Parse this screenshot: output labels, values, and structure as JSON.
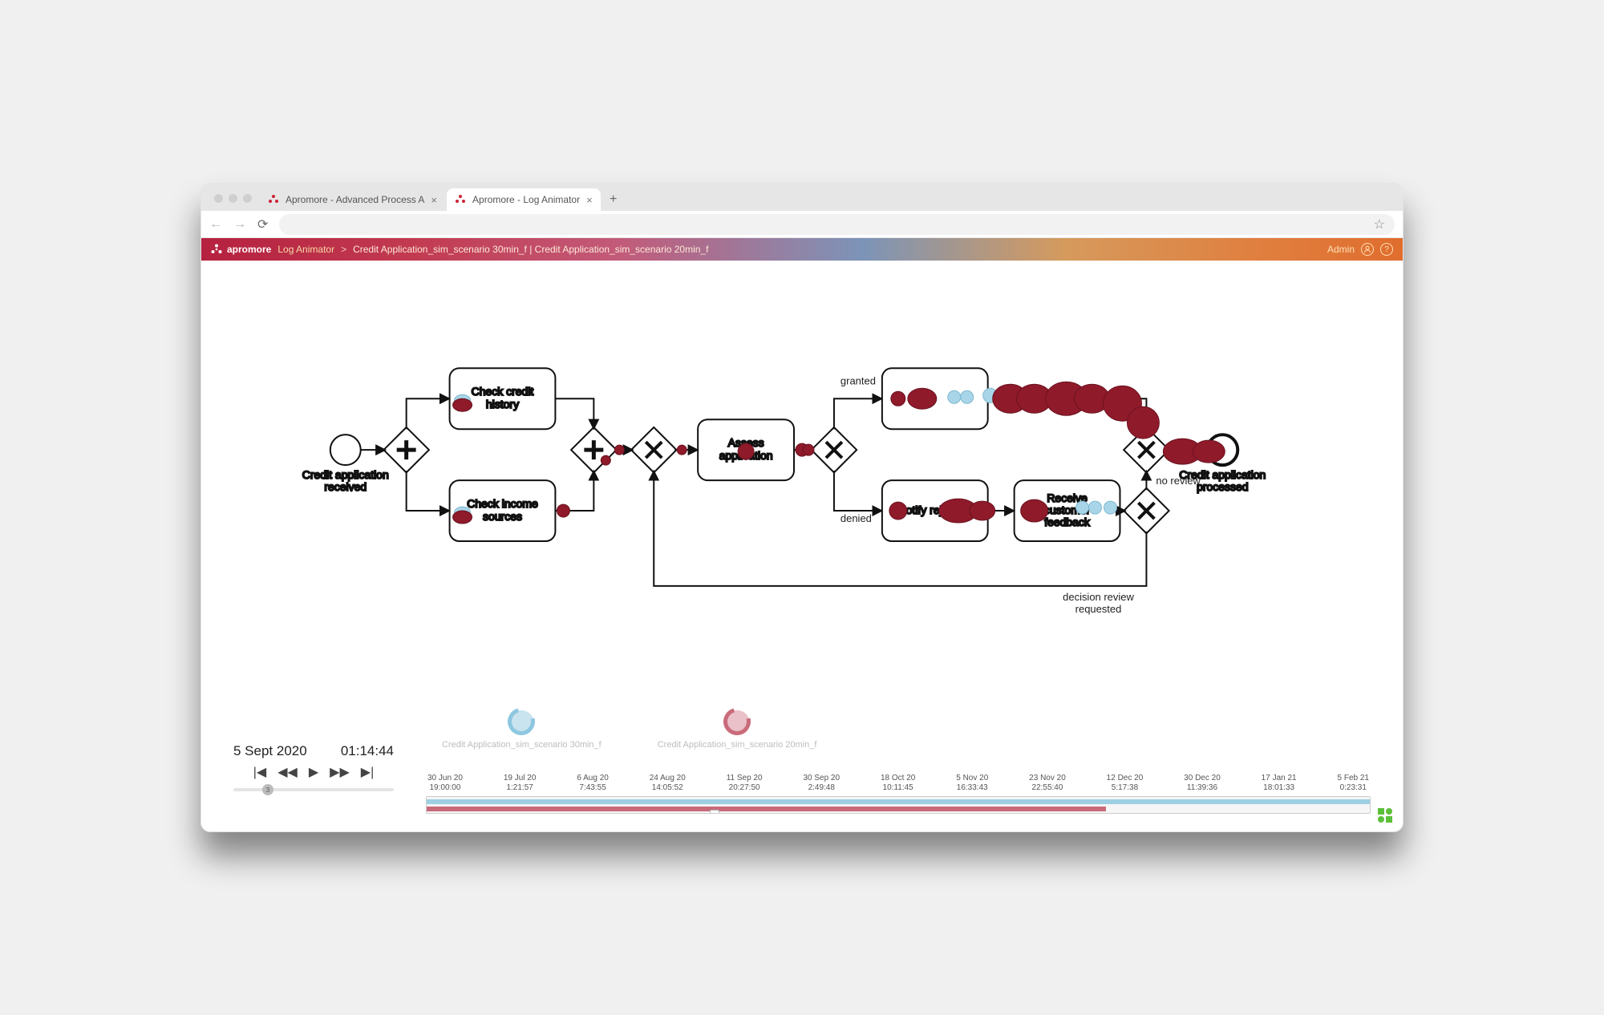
{
  "browser": {
    "tab1": "Apromore - Advanced Process A",
    "tab2": "Apromore - Log Animator",
    "star_tooltip": "Bookmark"
  },
  "appbar": {
    "brand": "apromore",
    "section": "Log Animator",
    "sep": ">",
    "breadcrumb": "Credit Application_sim_scenario 30min_f | Credit Application_sim_scenario 20min_f",
    "user": "Admin"
  },
  "nodes": {
    "start": [
      "Credit application",
      "received"
    ],
    "check_credit": [
      "Check credit",
      "history"
    ],
    "check_income": [
      "Check income",
      "sources"
    ],
    "assess": [
      "Assess",
      "application"
    ],
    "notify_rej": [
      "Notify rejection"
    ],
    "receive_fb": [
      "Receive",
      "customer",
      "feedback"
    ],
    "end": [
      "Credit application",
      "processed"
    ]
  },
  "edges": {
    "granted": "granted",
    "denied": "denied",
    "noreview": "no review",
    "decision": [
      "decision review",
      "requested"
    ]
  },
  "playback": {
    "date": "5 Sept 2020",
    "time": "01:14:44",
    "speed_label": "3"
  },
  "legend": {
    "s1": "Credit Application_sim_scenario 30min_f",
    "s2": "Credit Application_sim_scenario 20min_f"
  },
  "timeline": {
    "ticks": [
      {
        "d": "30 Jun 20",
        "t": "19:00:00"
      },
      {
        "d": "19 Jul 20",
        "t": "1:21:57"
      },
      {
        "d": "6 Aug 20",
        "t": "7:43:55"
      },
      {
        "d": "24 Aug 20",
        "t": "14:05:52"
      },
      {
        "d": "11 Sep 20",
        "t": "20:27:50"
      },
      {
        "d": "30 Sep 20",
        "t": "2:49:48"
      },
      {
        "d": "18 Oct 20",
        "t": "10:11:45"
      },
      {
        "d": "5 Nov 20",
        "t": "16:33:43"
      },
      {
        "d": "23 Nov 20",
        "t": "22:55:40"
      },
      {
        "d": "12 Dec 20",
        "t": "5:17:38"
      },
      {
        "d": "30 Dec 20",
        "t": "11:39:36"
      },
      {
        "d": "17 Jan 21",
        "t": "18:01:33"
      },
      {
        "d": "5 Feb 21",
        "t": "0:23:31"
      }
    ],
    "playhead_pct": 30.5
  },
  "colors": {
    "token_red": "#8f1a2a",
    "token_blue": "#a9d5e8"
  }
}
